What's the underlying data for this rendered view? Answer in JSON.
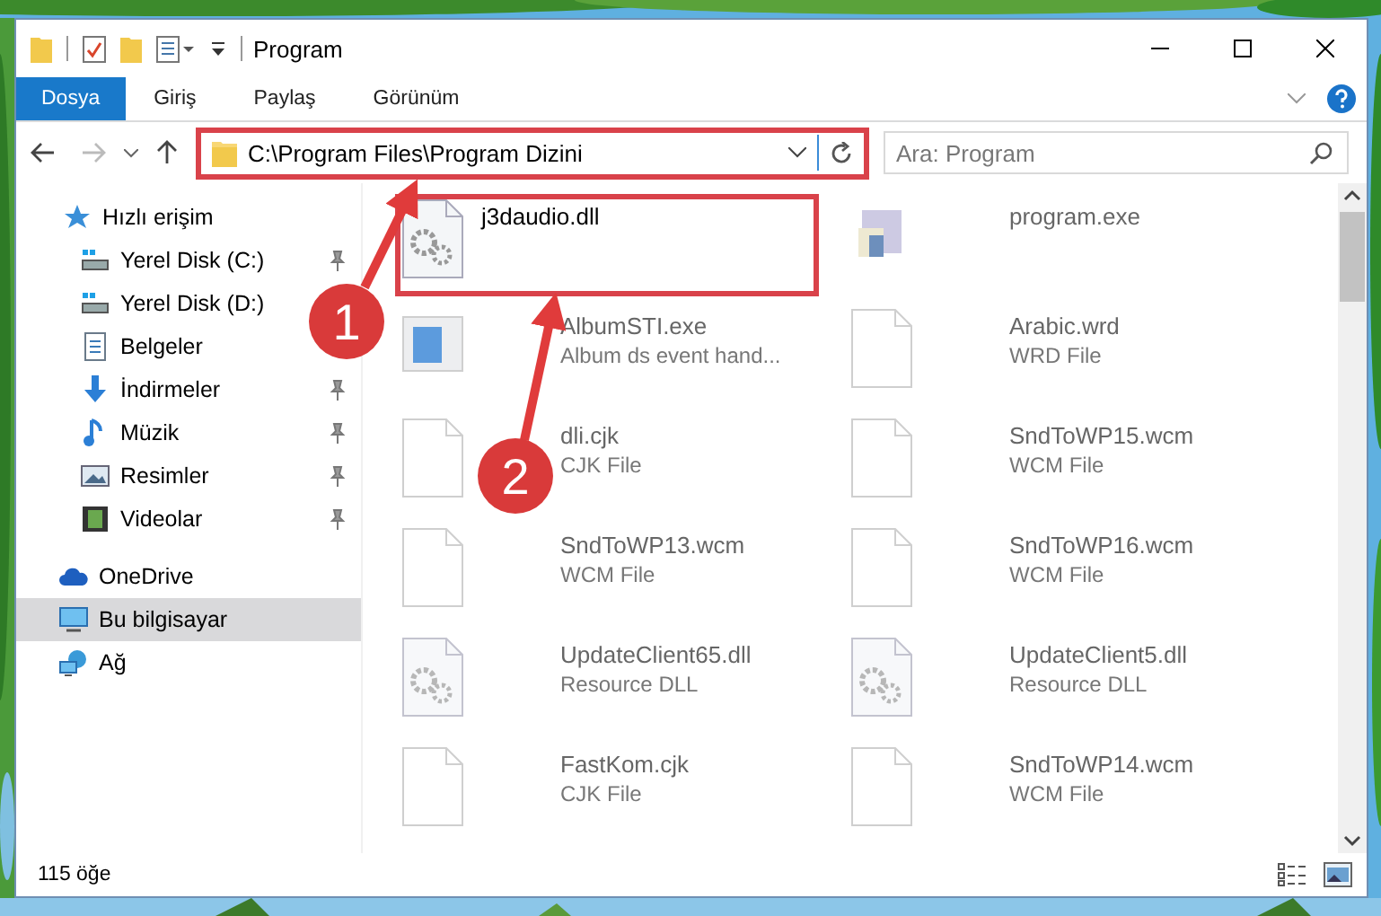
{
  "window": {
    "title": "Program"
  },
  "ribbon_tabs": [
    {
      "label": "Dosya",
      "selected": true
    },
    {
      "label": "Giriş",
      "selected": false
    },
    {
      "label": "Paylaş",
      "selected": false
    },
    {
      "label": "Görünüm",
      "selected": false
    }
  ],
  "address": {
    "value": "C:\\Program Files\\Program Dizini",
    "highlighted": true
  },
  "search": {
    "placeholder": "Ara: Program"
  },
  "sidebar": {
    "groups": [
      {
        "items": [
          {
            "label": "Hızlı erişim",
            "kind": "star",
            "pinned": false,
            "selected": false
          },
          {
            "label": "Yerel Disk (C:)",
            "kind": "drive",
            "pinned": true,
            "selected": false
          },
          {
            "label": "Yerel Disk (D:)",
            "kind": "drive",
            "pinned": false,
            "selected": false
          },
          {
            "label": "Belgeler",
            "kind": "doc",
            "pinned": false,
            "selected": false
          },
          {
            "label": "İndirmeler",
            "kind": "download",
            "pinned": true,
            "selected": false
          },
          {
            "label": "Müzik",
            "kind": "music",
            "pinned": true,
            "selected": false
          },
          {
            "label": "Resimler",
            "pinned": true,
            "selected": false
          },
          {
            "label": "Videolar",
            "kind": "video",
            "pinned": true,
            "selected": false
          }
        ]
      },
      {
        "items": [
          {
            "label": "OneDrive",
            "kind": "cloud",
            "pinned": false,
            "selected": false
          },
          {
            "label": "Bu bilgisayar",
            "kind": "pc",
            "pinned": false,
            "selected": true
          },
          {
            "label": "Ağ",
            "kind": "network",
            "pinned": false,
            "selected": false
          }
        ]
      }
    ]
  },
  "files": [
    {
      "name": "j3daudio.dll",
      "kind": "dll",
      "highlighted": true,
      "faded": false
    },
    {
      "name": "program.exe",
      "kind": "exe",
      "highlighted": false,
      "faded": true
    },
    {
      "name": "AlbumSTI.exe",
      "type": "Album ds event hand...",
      "kind": "app",
      "highlighted": false,
      "faded": true
    },
    {
      "name": "Arabic.wrd",
      "type": "WRD File",
      "kind": "file",
      "highlighted": false,
      "faded": true
    },
    {
      "name": "dli.cjk",
      "type": "CJK File",
      "kind": "file",
      "highlighted": false,
      "faded": true
    },
    {
      "name": "SndToWP15.wcm",
      "type": "WCM File",
      "kind": "file",
      "highlighted": false,
      "faded": true
    },
    {
      "name": "SndToWP13.wcm",
      "type": "WCM File",
      "kind": "file",
      "highlighted": false,
      "faded": true
    },
    {
      "name": "SndToWP16.wcm",
      "type": "WCM File",
      "kind": "file",
      "highlighted": false,
      "faded": true
    },
    {
      "name": "UpdateClient65.dll",
      "type": "Resource DLL",
      "kind": "dll",
      "highlighted": false,
      "faded": true
    },
    {
      "name": "UpdateClient5.dll",
      "type": "Resource DLL",
      "kind": "dll",
      "highlighted": false,
      "faded": true
    },
    {
      "name": "FastKom.cjk",
      "type": "CJK File",
      "kind": "file",
      "highlighted": false,
      "faded": true
    },
    {
      "name": "SndToWP14.wcm",
      "type": "WCM File",
      "kind": "file",
      "highlighted": false,
      "faded": true
    }
  ],
  "status_bar": {
    "item_count": "115 öğe"
  },
  "callouts": [
    {
      "number": "1"
    },
    {
      "number": "2"
    }
  ]
}
